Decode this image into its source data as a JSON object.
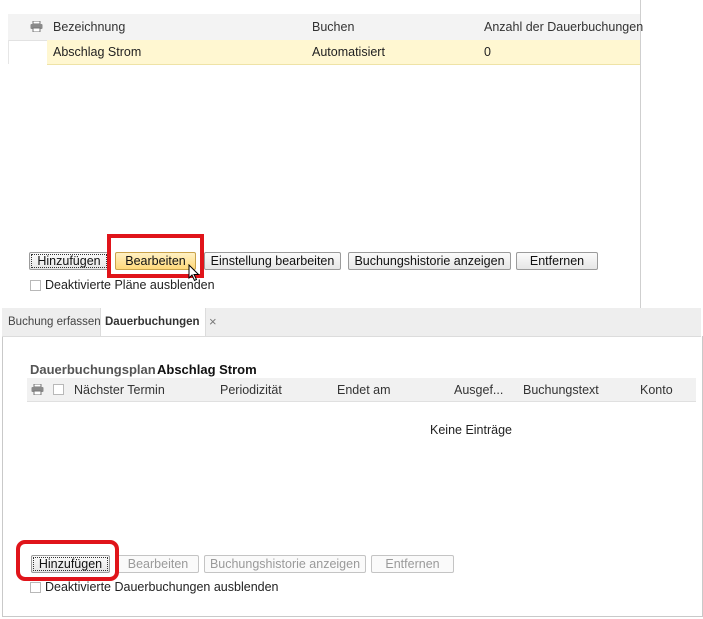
{
  "top_grid": {
    "columns": [
      "Bezeichnung",
      "Buchen",
      "Anzahl der Dauerbuchungen"
    ],
    "rows": [
      {
        "bezeichnung": "Abschlag Strom",
        "buchen": "Automatisiert",
        "anzahl": "0"
      }
    ]
  },
  "top_buttons": {
    "add": "Hinzufügen",
    "edit": "Bearbeiten",
    "edit_settings": "Einstellung bearbeiten",
    "history": "Buchungshistorie anzeigen",
    "remove": "Entfernen"
  },
  "top_checkbox_label": "Deaktivierte Pläne ausblenden",
  "tabs": [
    {
      "label": "Buchung erfassen",
      "active": false
    },
    {
      "label": "Dauerbuchungen",
      "active": true,
      "close": "×"
    }
  ],
  "plan": {
    "label": "Dauerbuchungsplan",
    "name": "Abschlag Strom"
  },
  "bottom_grid": {
    "columns": [
      "Nächster Termin",
      "Periodizität",
      "Endet am",
      "Ausgef...",
      "Buchungstext",
      "Konto"
    ],
    "empty_text": "Keine Einträge"
  },
  "bottom_buttons": {
    "add": "Hinzufügen",
    "edit": "Bearbeiten",
    "history": "Buchungshistorie anzeigen",
    "remove": "Entfernen"
  },
  "bottom_checkbox_label": "Deaktivierte Dauerbuchungen ausblenden",
  "colors": {
    "selected_row": "#fff7d1",
    "highlight_button": "#ffd97a",
    "annotation_red": "#e0141a"
  },
  "icons": [
    "print-icon",
    "close-icon",
    "cursor-icon"
  ]
}
